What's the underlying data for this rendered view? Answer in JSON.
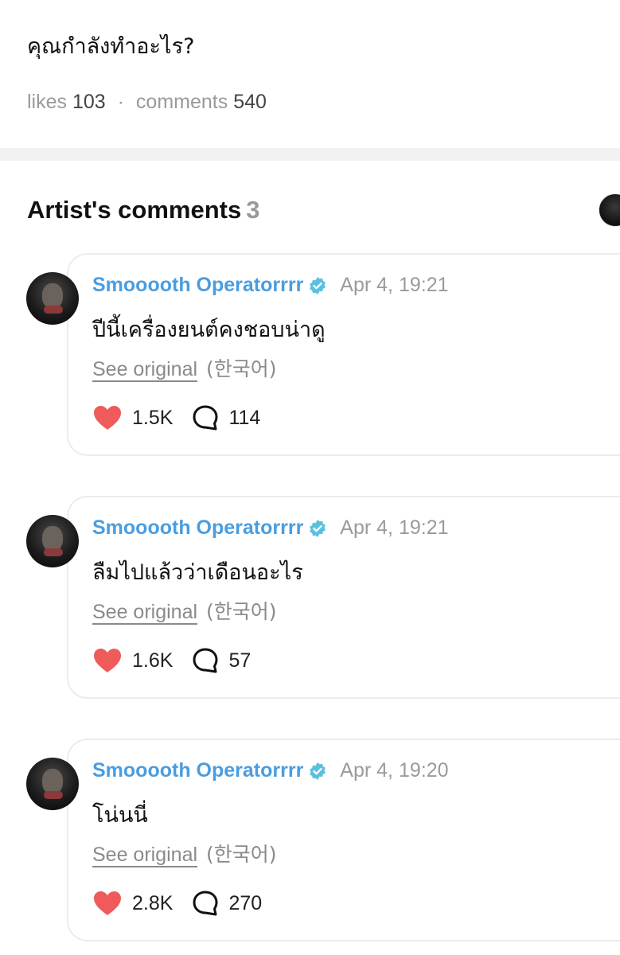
{
  "post": {
    "text": "คุณกำลังทำอะไร?",
    "likes_label": "likes",
    "likes_count": "103",
    "comments_label": "comments",
    "comments_count": "540"
  },
  "artist_section": {
    "title": "Artist's comments",
    "count": "3"
  },
  "comments": [
    {
      "author": "Smooooth Operatorrrr",
      "time": "Apr 4, 19:21",
      "text": "ปีนี้เครื่องยนต์คงชอบน่าดู",
      "see_original": "See original",
      "language": "(한국어)",
      "likes": "1.5K",
      "replies": "114"
    },
    {
      "author": "Smooooth Operatorrrr",
      "time": "Apr 4, 19:21",
      "text": "ลืมไปแล้วว่าเดือนอะไร",
      "see_original": "See original",
      "language": "(한국어)",
      "likes": "1.6K",
      "replies": "57"
    },
    {
      "author": "Smooooth Operatorrrr",
      "time": "Apr 4, 19:20",
      "text": "โน่นนี่",
      "see_original": "See original",
      "language": "(한국어)",
      "likes": "2.8K",
      "replies": "270"
    }
  ],
  "colors": {
    "author": "#4a9de0",
    "verified": "#5bc0de",
    "heart": "#ef5b5b",
    "muted": "#9a9a9a"
  },
  "icons": [
    "verified-badge-icon",
    "heart-icon",
    "comment-bubble-icon"
  ]
}
